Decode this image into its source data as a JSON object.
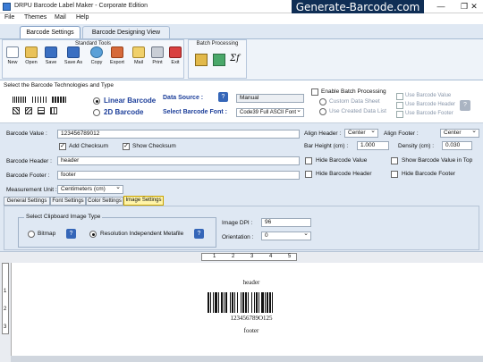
{
  "window": {
    "title": "DRPU Barcode Label Maker - Corporate Edition",
    "banner": "Generate-Barcode.com",
    "min": "—",
    "max": "❐",
    "close": "✕"
  },
  "menu": [
    "File",
    "Themes",
    "Mail",
    "Help"
  ],
  "tabs": [
    "Barcode Settings",
    "Barcode Designing View"
  ],
  "toolbar": {
    "std_title": "Standard Tools",
    "batch_title": "Batch Processing",
    "buttons": [
      "New",
      "Open",
      "Save",
      "Save As",
      "Copy",
      "Export",
      "Mail",
      "Print",
      "Exit"
    ]
  },
  "tech": {
    "section_title": "Select the Barcode Technologies and Type",
    "linear": "Linear Barcode",
    "twod": "2D Barcode",
    "data_source_label": "Data Source :",
    "data_source_value": "Manual",
    "font_label": "Select Barcode Font :",
    "font_value": "Code39 Full ASCII Font",
    "enable_batch": "Enable Batch Processing",
    "custom_sheet": "Custom Data Sheet",
    "created_list": "Use Created Data List",
    "use_value": "Use Barcode Value",
    "use_header": "Use Barcode Header",
    "use_footer": "Use Barcode Footer"
  },
  "form": {
    "value_label": "Barcode Value :",
    "value": "123456789012",
    "add_checksum": "Add Checksum",
    "show_checksum": "Show Checksum",
    "header_label": "Barcode Header :",
    "header": "header",
    "footer_label": "Barcode Footer :",
    "footer": "footer",
    "unit_label": "Measurement Unit :",
    "unit": "Centimeters (cm)",
    "align_header_label": "Align Header :",
    "align_header": "Center",
    "align_footer_label": "Align Footer :",
    "align_footer": "Center",
    "bar_height_label": "Bar Height (cm) :",
    "bar_height": "1.000",
    "density_label": "Density (cm) :",
    "density": "0.030",
    "hide_value": "Hide Barcode Value",
    "show_value_top": "Show Barcode Value in Top",
    "hide_header": "Hide Barcode Header",
    "hide_footer": "Hide Barcode Footer"
  },
  "subtabs": [
    "General Settings",
    "Font Settings",
    "Color Settings",
    "Image Settings"
  ],
  "image": {
    "group_title": "Select Clipboard Image Type",
    "bitmap": "Bitmap",
    "metafile": "Resolution Independent Metafile",
    "dpi_label": "Image DPI :",
    "dpi": "96",
    "orientation_label": "Orientation :",
    "orientation": "0"
  },
  "preview": {
    "ruler_top": [
      "1",
      "2",
      "3",
      "4",
      "5"
    ],
    "ruler_left": [
      "1",
      "2",
      "3"
    ],
    "header": "header",
    "digits": "123456789O125",
    "footer": "footer"
  }
}
